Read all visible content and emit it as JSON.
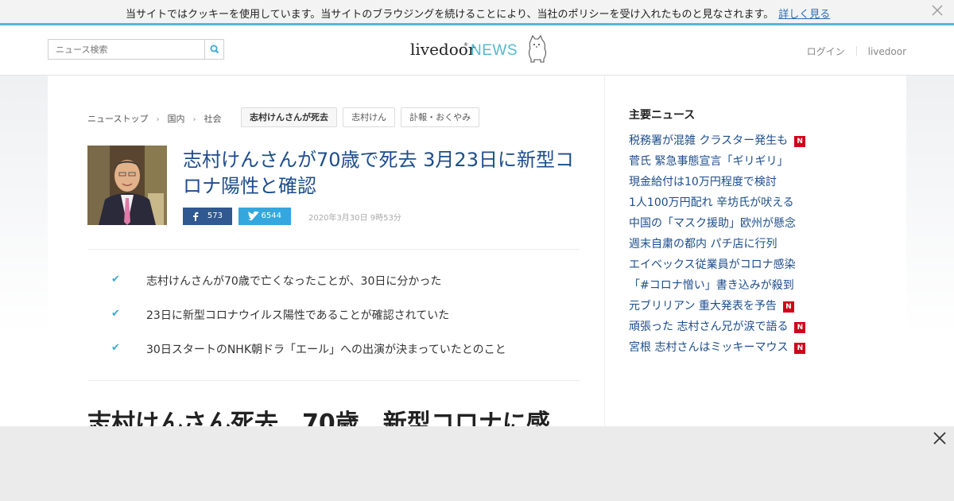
{
  "cookie_bar": {
    "message": "当サイトではクッキーを使用しています。当サイトのブラウジングを続けることにより、当社のポリシーを受け入れたものと見なされます。",
    "more_link": "詳しく見る",
    "close_icon": "close-icon"
  },
  "header": {
    "search_placeholder": "ニュース検索",
    "search_icon": "search-icon",
    "logo_text": "livedoor",
    "logo_news": "NEWS",
    "login": "ログイン",
    "livedoor_link": "livedoor"
  },
  "breadcrumb": [
    "ニューストップ",
    "国内",
    "社会"
  ],
  "tags": [
    "志村けんさんが死去",
    "志村けん",
    "訃報・おくやみ"
  ],
  "article": {
    "title": "志村けんさんが70歳で死去 3月23日に新型コロナ陽性と確認",
    "facebook_count": "573",
    "twitter_count": "6544",
    "date": "2020年3月30日 9時53分",
    "points": [
      "志村けんさんが70歳で亡くなったことが、30日に分かった",
      "23日に新型コロナウイルス陽性であることが確認されていた",
      "30日スタートのNHK朝ドラ「エール」への出演が決まっていたとのこと"
    ],
    "headline2": "志村けんさん死去　70歳　新型コロナに感"
  },
  "sidebar": {
    "title": "主要ニュース",
    "news": [
      {
        "text": "税務署が混雑 クラスター発生も",
        "badge": "N"
      },
      {
        "text": "菅氏 緊急事態宣言「ギリギリ」",
        "badge": ""
      },
      {
        "text": "現金給付は10万円程度で検討",
        "badge": ""
      },
      {
        "text": "1人100万円配れ 辛坊氏が吠える",
        "badge": ""
      },
      {
        "text": "中国の「マスク援助」欧州が懸念",
        "badge": ""
      },
      {
        "text": "週末自粛の都内 パチ店に行列",
        "badge": ""
      },
      {
        "text": "エイベックス従業員がコロナ感染",
        "badge": ""
      },
      {
        "text": "「#コロナ憎い」書き込みが殺到",
        "badge": ""
      },
      {
        "text": "元ブリリアン 重大発表を予告",
        "badge": "N"
      },
      {
        "text": "頑張った 志村さん兄が涙で語る",
        "badge": "N"
      },
      {
        "text": "宮根 志村さんはミッキーマウス",
        "badge": "N"
      }
    ]
  },
  "colors": {
    "accent": "#55b8d0",
    "title_blue": "#1d4d8c",
    "facebook": "#305891",
    "twitter": "#33a7de",
    "badge_red": "#d0021b"
  }
}
